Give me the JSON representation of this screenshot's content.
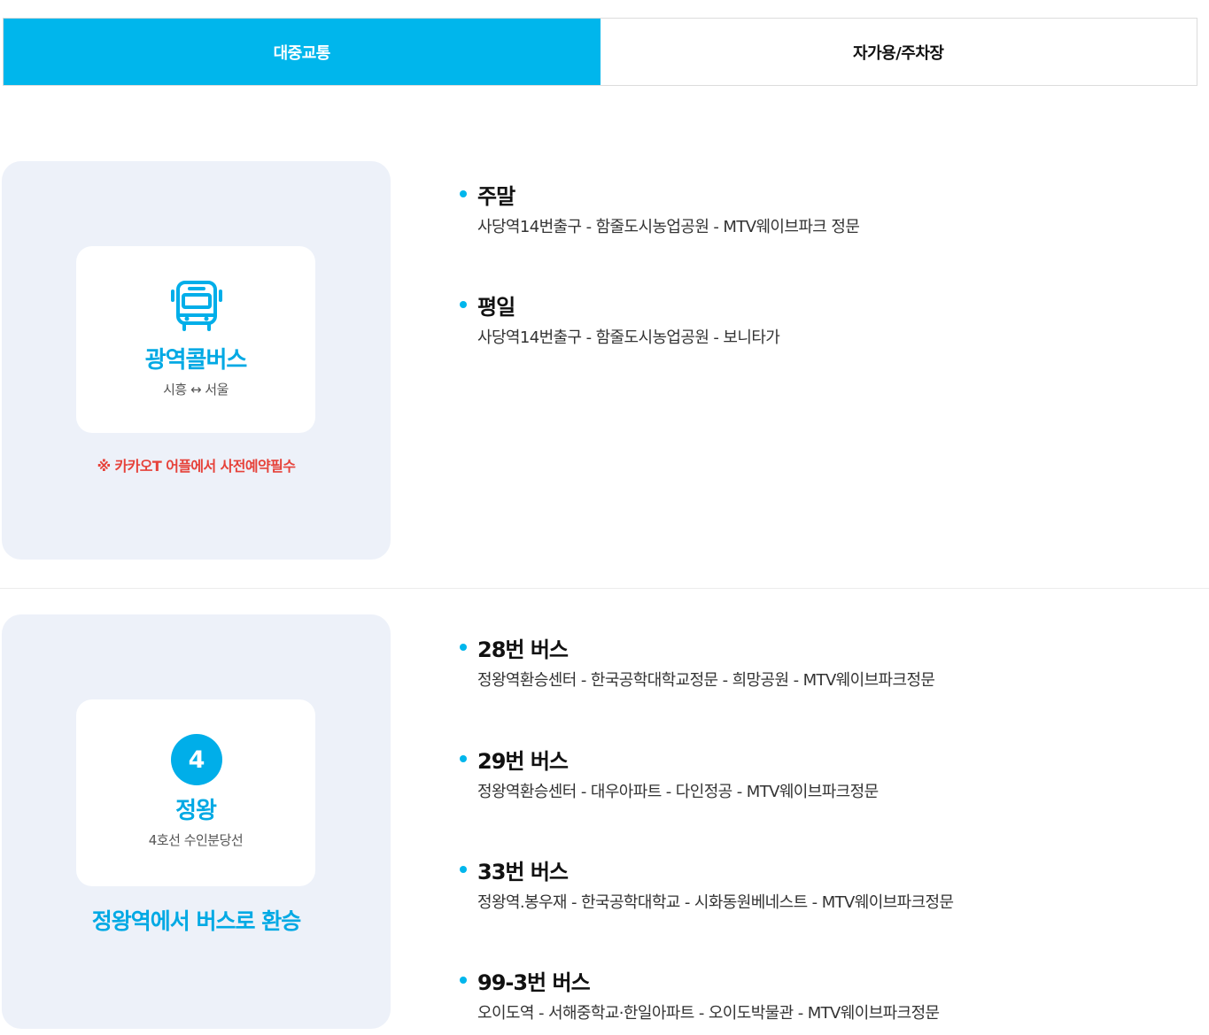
{
  "tabs": [
    {
      "label": "대중교통",
      "active": true
    },
    {
      "label": "자가용/주차장",
      "active": false
    }
  ],
  "colors": {
    "accent": "#00b6ec",
    "panel_bg": "#edf1f9",
    "warning": "#e6423a"
  },
  "section1": {
    "icon": "bus-icon",
    "title": "광역콜버스",
    "subtitle": "시흥 ↔ 서울",
    "note": "※ 카카오T 어플에서 사전예약필수",
    "routes": [
      {
        "title": "주말",
        "path": "사당역14번출구 - 함줄도시농업공원 -  MTV웨이브파크 정문"
      },
      {
        "title": "평일",
        "path": "사당역14번출구 - 함줄도시농업공원 - 보니타가"
      }
    ]
  },
  "section2": {
    "line_number": "4",
    "title": "정왕",
    "subtitle": "4호선 수인분당선",
    "note": "정왕역에서 버스로 환승",
    "routes": [
      {
        "title": "28번 버스",
        "path": "정왕역환승센터  -  한국공학대학교정문  -  희망공원  -  MTV웨이브파크정문"
      },
      {
        "title": "29번 버스",
        "path": "정왕역환승센터 - 대우아파트 - 다인정공 - MTV웨이브파크정문"
      },
      {
        "title": "33번 버스",
        "path": "정왕역.봉우재 - 한국공학대학교 - 시화동원베네스트 - MTV웨이브파크정문"
      },
      {
        "title": "99-3번 버스",
        "path": "오이도역 - 서해중학교·한일아파트 - 오이도박물관 - MTV웨이브파크정문"
      }
    ]
  }
}
